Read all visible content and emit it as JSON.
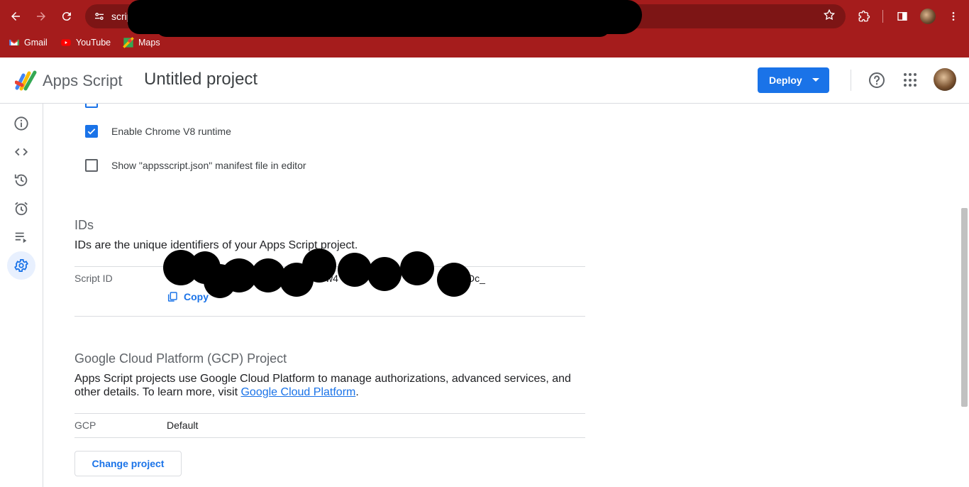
{
  "browser": {
    "url_visible": "scrip",
    "bookmarks": [
      {
        "label": "Gmail",
        "icon": "gmail-icon"
      },
      {
        "label": "YouTube",
        "icon": "youtube-icon"
      },
      {
        "label": "Maps",
        "icon": "maps-icon"
      }
    ],
    "accent": "#a51c1c"
  },
  "header": {
    "brand": "Apps Script",
    "project_title": "Untitled project",
    "deploy_label": "Deploy"
  },
  "rail": {
    "items": [
      {
        "name": "overview",
        "icon": "info-icon"
      },
      {
        "name": "editor",
        "icon": "code-icon"
      },
      {
        "name": "history",
        "icon": "history-icon"
      },
      {
        "name": "triggers",
        "icon": "alarm-icon"
      },
      {
        "name": "executions",
        "icon": "executions-icon"
      },
      {
        "name": "settings",
        "icon": "gear-icon",
        "active": true
      }
    ]
  },
  "settings": {
    "v8_label": "Enable Chrome V8 runtime",
    "v8_checked": true,
    "manifest_label": "Show \"appsscript.json\" manifest file in editor",
    "manifest_checked": false,
    "ids": {
      "title": "IDs",
      "description": "IDs are the unique identifiers of your Apps Script project.",
      "script_id_label": "Script ID",
      "script_id_visible_end": "Dc_",
      "script_id_visible_mid": "w4",
      "copy_label": "Copy"
    },
    "gcp": {
      "title": "Google Cloud Platform (GCP) Project",
      "description_1": "Apps Script projects use Google Cloud Platform to manage authorizations, advanced services, and other details. To learn more, visit ",
      "link_text": "Google Cloud Platform",
      "description_2": ".",
      "key_label": "GCP",
      "value": "Default",
      "change_button": "Change project"
    }
  },
  "colors": {
    "primary": "#1a73e8",
    "active_rail_bg": "#e8f0fe"
  }
}
